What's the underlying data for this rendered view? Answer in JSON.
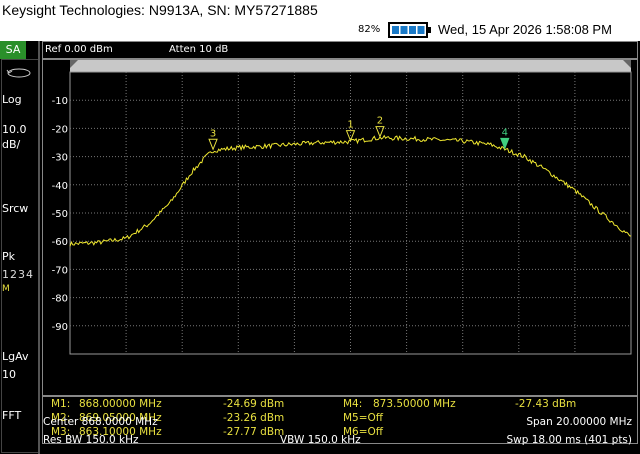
{
  "app": {
    "title": "Keysight Technologies: N9913A, SN: MY57271885"
  },
  "status": {
    "battery_percent": "82%",
    "datetime": "Wed, 15 Apr 2026  1:58:08 PM"
  },
  "sidebar": {
    "mode": "SA",
    "scale_type": "Log",
    "scale_value": "10.0",
    "scale_unit": "dB/",
    "sweep_mode": "Srcw",
    "detector": "Pk",
    "traces": "1234",
    "trace_mode": "M",
    "average": "LgAv",
    "average_count": "10",
    "fft": "FFT"
  },
  "header": {
    "ref_level": "Ref 0.00 dBm",
    "attenuation": "Atten 10 dB"
  },
  "plot": {
    "y_ticks": [
      "-10",
      "-20",
      "-30",
      "-40",
      "-50",
      "-60",
      "-70",
      "-80",
      "-90"
    ],
    "marker_labels": [
      "1",
      "2",
      "3",
      "4"
    ]
  },
  "markers": [
    {
      "name": "M1:",
      "freq": "868.00000 MHz",
      "value": "-24.69 dBm"
    },
    {
      "name": "M2:",
      "freq": "869.05000 MHz",
      "value": "-23.26 dBm"
    },
    {
      "name": "M3:",
      "freq": "863.10000 MHz",
      "value": "-27.77 dBm"
    },
    {
      "name": "M4:",
      "freq": "873.50000 MHz",
      "value": "-27.43 dBm"
    },
    {
      "name": "M5=Off"
    },
    {
      "name": "M6=Off"
    }
  ],
  "footer": {
    "center": "Center 868.0000 MHz",
    "span": "Span 20.00000 MHz",
    "rbw": "Res BW 150.0 kHz",
    "vbw": "VBW 150.0 kHz",
    "sweep": "Swp 18.00 ms (401 pts)"
  },
  "chart_data": {
    "type": "line",
    "x_unit": "MHz",
    "y_unit": "dBm",
    "xlim": [
      858.0,
      878.0
    ],
    "ylim": [
      -100,
      0
    ],
    "grid": true,
    "series": [
      {
        "x": [
          858.0,
          859.0,
          860.0,
          860.8,
          861.6,
          862.3,
          862.8,
          863.1,
          864.0,
          865.0,
          866.0,
          867.0,
          868.0,
          869.05,
          870.0,
          871.0,
          872.0,
          873.0,
          873.5,
          874.2,
          875.0,
          876.0,
          877.0,
          878.0
        ],
        "values": [
          -61.0,
          -60.5,
          -59.0,
          -54.0,
          -46.0,
          -36.0,
          -30.5,
          -27.8,
          -26.8,
          -26.3,
          -25.6,
          -25.0,
          -24.7,
          -23.3,
          -23.6,
          -24.0,
          -24.5,
          -25.8,
          -27.4,
          -30.0,
          -35.0,
          -42.0,
          -50.5,
          -58.5
        ]
      }
    ],
    "markers": [
      {
        "label": "1",
        "x": 868.0,
        "y": -24.69
      },
      {
        "label": "2",
        "x": 869.05,
        "y": -23.26
      },
      {
        "label": "3",
        "x": 863.1,
        "y": -27.77
      },
      {
        "label": "4",
        "x": 873.5,
        "y": -27.43,
        "active": true
      }
    ],
    "colors": {
      "trace": "#f0e830",
      "grid": "#777777",
      "marker_active": "#40d080"
    }
  }
}
